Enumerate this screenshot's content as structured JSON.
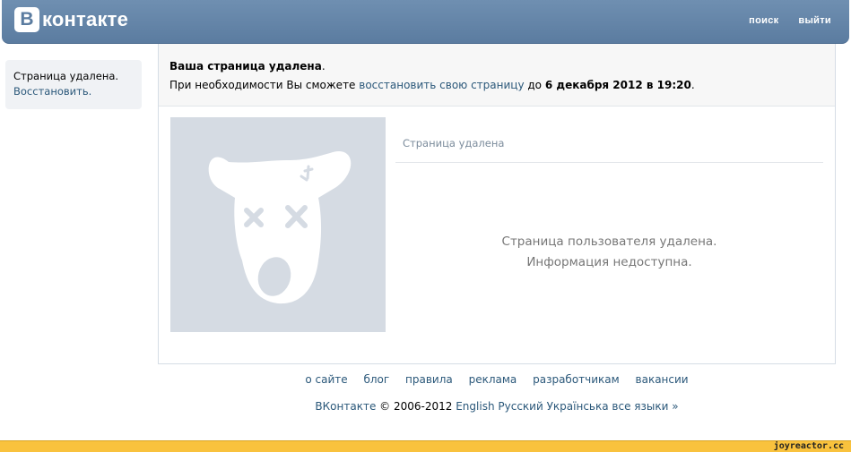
{
  "header": {
    "logo_letter": "B",
    "logo_text": "контакте",
    "nav": {
      "search": "поиск",
      "logout": "выйти"
    }
  },
  "sidebar": {
    "status": "Страница удалена.",
    "restore": "Восстановить."
  },
  "notice": {
    "title": "Ваша страница удалена",
    "title_dot": ".",
    "line_prefix": "При необходимости Вы сможете ",
    "link": "восстановить свою страницу",
    "line_mid": " до ",
    "deadline": "6 декабря 2012 в 19:20",
    "line_end": "."
  },
  "profile": {
    "deleted_label": "Страница удалена",
    "info_line1": "Страница пользователя удалена.",
    "info_line2": "Информация недоступна."
  },
  "footer": {
    "links": [
      "о сайте",
      "блог",
      "правила",
      "реклама",
      "разработчикам",
      "вакансии"
    ],
    "brand": "ВКонтакте",
    "copyright": "© 2006-2012",
    "languages": [
      "English",
      "Русский",
      "Українська",
      "все языки »"
    ]
  },
  "watermark": "joyreactor.cc",
  "colors": {
    "header": "#5b7ca0",
    "link": "#2b587a",
    "bottom_bar": "#f9c23d"
  }
}
